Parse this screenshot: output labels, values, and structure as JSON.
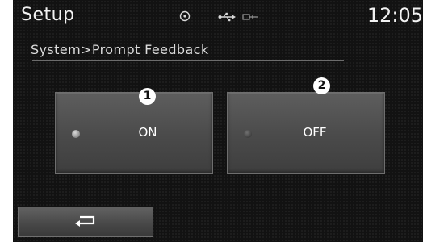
{
  "header": {
    "title": "Setup",
    "clock": "12:05"
  },
  "status_icons": [
    "disc-icon",
    "usb-icon",
    "aux-plug-icon"
  ],
  "breadcrumb": "System>Prompt Feedback",
  "options": [
    {
      "callout": "1",
      "label": "ON",
      "selected": true
    },
    {
      "callout": "2",
      "label": "OFF",
      "selected": false
    }
  ],
  "footer": {
    "back_icon": "back-arrow-icon"
  }
}
